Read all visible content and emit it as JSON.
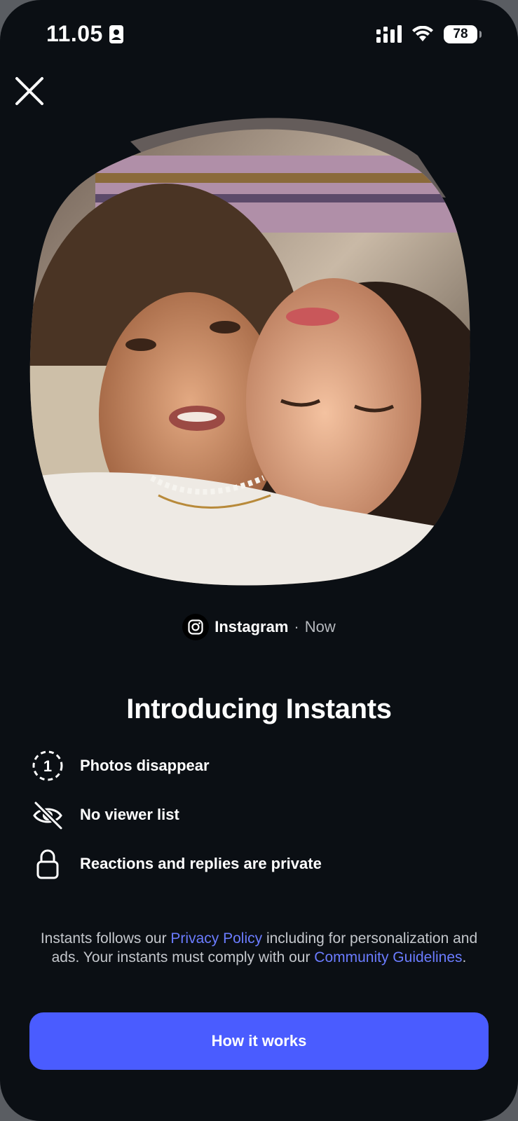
{
  "status_bar": {
    "time": "11.05",
    "battery": "78"
  },
  "close": {
    "icon": "close-icon"
  },
  "hero": {
    "icon": "photo-of-two-girls"
  },
  "source": {
    "app": "Instagram",
    "separator": "·",
    "time": "Now",
    "icon": "instagram-icon"
  },
  "title": "Introducing Instants",
  "features": [
    {
      "icon": "disappear-timer-icon",
      "label": "Photos disappear"
    },
    {
      "icon": "eye-off-icon",
      "label": "No viewer list"
    },
    {
      "icon": "lock-icon",
      "label": "Reactions and replies are private"
    }
  ],
  "legal": {
    "part1": "Instants follows our ",
    "privacy_link": "Privacy Policy",
    "part2": " including for personalization and ads. Your instants must comply with our ",
    "guidelines_link": "Community Guidelines",
    "part3": "."
  },
  "cta": {
    "label": "How it works"
  },
  "colors": {
    "background": "#0b0f14",
    "accent": "#4a5cff",
    "link": "#6b7cff"
  }
}
